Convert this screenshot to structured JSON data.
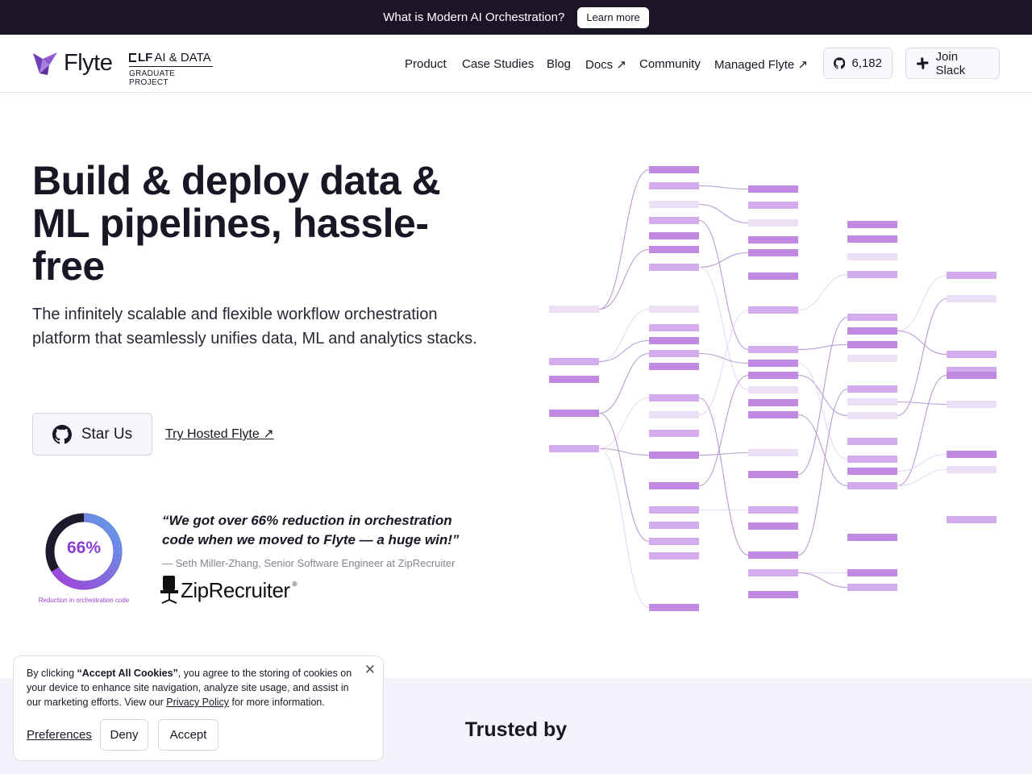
{
  "announcement": {
    "message": "What is Modern AI Orchestration?",
    "button": "Learn more"
  },
  "nav": {
    "logo": "Flyte",
    "lf_top_a": "LF",
    "lf_top_b": "AI & DATA",
    "lf_bottom": "GRADUATE PROJECT",
    "items": [
      "Product",
      "Case Studies",
      "Blog",
      "Docs ↗",
      "Community",
      "Managed Flyte ↗"
    ],
    "github_stars": "6,182",
    "slack": "Join Slack"
  },
  "hero": {
    "title": "Build & deploy data & ML pipelines, hassle-free",
    "subtitle": "The infinitely scalable and flexible workflow orchestration platform that seamlessly unifies data, ML and analytics stacks.",
    "star_button": "Star Us",
    "hosted_link": "Try Hosted Flyte ↗"
  },
  "testimonial": {
    "stat": "66%",
    "stat_fraction": 0.66,
    "stat_caption": "Reduction in orchestration code",
    "quote": "“We got over 66% reduction in orchestration code when we moved to Flyte — a huge win!”",
    "attribution": "— Seth Miller-Zhang, Senior Software Engineer at ZipRecruiter",
    "company_logo": "ZipRecruiter",
    "company_tm": "®"
  },
  "trusted": {
    "heading": "Trusted by"
  },
  "cookie": {
    "text_pre": "By clicking ",
    "text_bold": "“Accept All Cookies”",
    "text_mid": ", you agree to the storing of cookies on your device to enhance site navigation, analyze site usage, and assist in our marketing efforts. View our ",
    "link": "Privacy Policy",
    "text_post": " for more information.",
    "close": "✕",
    "preferences": "Preferences",
    "deny": "Deny",
    "accept": "Accept"
  },
  "colors": {
    "accent": "#8a3fd0",
    "node_dark": "#c08ae2",
    "node_mid": "#d2aced",
    "node_light": "#ece0f6",
    "topbar": "#1c1528",
    "band": "#f4f3fb"
  },
  "icons": [
    "flyte-logo-icon",
    "github-icon",
    "slack-icon",
    "arrow-up-right-icon",
    "close-icon",
    "zip-chair-icon"
  ]
}
